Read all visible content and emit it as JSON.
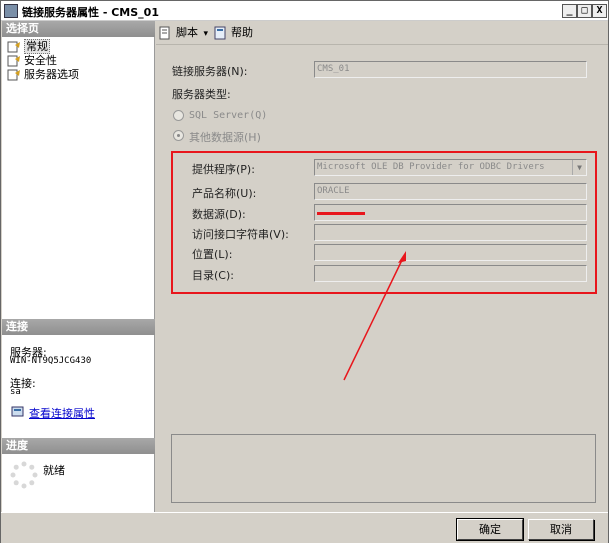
{
  "window": {
    "title": "链接服务器属性 - CMS_01",
    "min_btn": "_",
    "max_btn": "□",
    "close_btn": "X"
  },
  "left": {
    "select_page_header": "选择页",
    "pages": [
      {
        "label": "常规",
        "selected": true
      },
      {
        "label": "安全性",
        "selected": false
      },
      {
        "label": "服务器选项",
        "selected": false
      }
    ],
    "connection_header": "连接",
    "server_label": "服务器:",
    "server_value": "WIN-NT9Q5JCG430",
    "connection_label": "连接:",
    "connection_value": "sa",
    "view_link": "查看连接属性",
    "progress_header": "进度",
    "progress_status": "就绪"
  },
  "toolbar": {
    "script_label": "脚本",
    "script_arrow": "▾",
    "help_label": "帮助"
  },
  "form": {
    "linked_server_label": "链接服务器(N):",
    "linked_server_value": "CMS_01",
    "server_type_label": "服务器类型:",
    "sql_server_option": "SQL Server(Q)",
    "other_source_option": "其他数据源(H)",
    "provider_label": "提供程序(P):",
    "provider_value": "Microsoft OLE DB Provider for ODBC Drivers",
    "product_label": "产品名称(U):",
    "product_value": "ORACLE",
    "datasource_label": "数据源(D):",
    "datasource_value": "",
    "provider_string_label": "访问接口字符串(V):",
    "provider_string_value": "",
    "location_label": "位置(L):",
    "location_value": "",
    "catalog_label": "目录(C):",
    "catalog_value": ""
  },
  "buttons": {
    "ok": "确定",
    "cancel": "取消"
  },
  "colors": {
    "annotation": "#e8161c",
    "window_bg": "#d4d0c8",
    "section_header": "#9a9a9a",
    "link": "#0000cc"
  }
}
